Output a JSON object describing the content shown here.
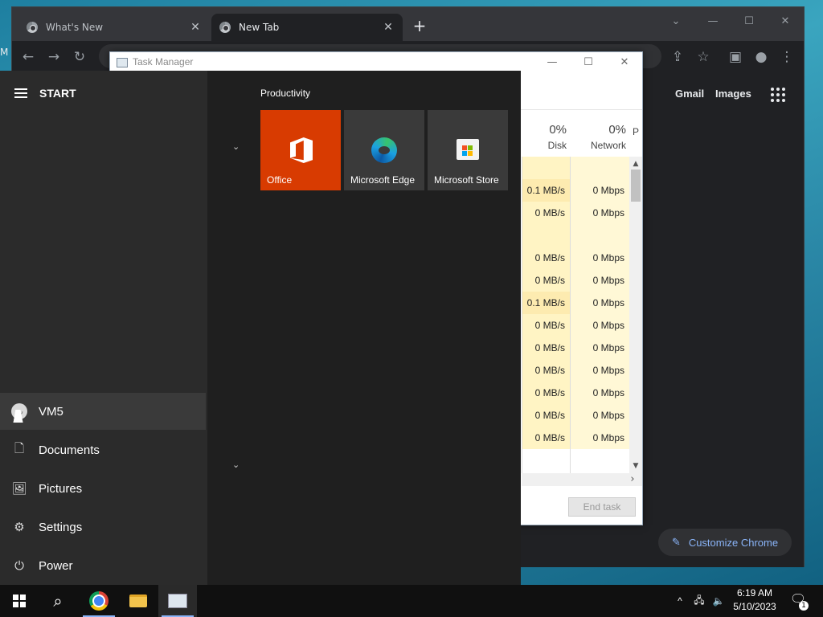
{
  "chrome": {
    "tabs": [
      {
        "title": "What's New",
        "close": "✕"
      },
      {
        "title": "New Tab",
        "close": "✕"
      }
    ],
    "new_tab": "+",
    "window_controls": {
      "dropdown": "⌄",
      "minimize": "—",
      "maximize": "☐",
      "close": "✕"
    },
    "toolbar": {
      "back": "←",
      "forward": "→",
      "reload": "↻",
      "share": "⇪",
      "bookmark": "☆",
      "sidepanel": "▣",
      "profile": "●",
      "menu": "⋮"
    },
    "side_letter": "M",
    "ntp": {
      "gmail": "Gmail",
      "images": "Images",
      "customize": "Customize Chrome",
      "customize_icon": "✎"
    }
  },
  "task_manager": {
    "title": "Task Manager",
    "controls": {
      "minimize": "—",
      "maximize": "☐",
      "close": "✕"
    },
    "columns": [
      {
        "pct": "0%",
        "label": "Disk"
      },
      {
        "pct": "0%",
        "label": "Network"
      },
      {
        "pct": "",
        "label": "P"
      }
    ],
    "disk_values": [
      "",
      "0.1 MB/s",
      "0 MB/s",
      "",
      "0 MB/s",
      "0 MB/s",
      "0.1 MB/s",
      "0 MB/s",
      "0 MB/s",
      "0 MB/s",
      "0 MB/s",
      "0 MB/s",
      "0 MB/s"
    ],
    "network_values": [
      "",
      "0 Mbps",
      "0 Mbps",
      "",
      "0 Mbps",
      "0 Mbps",
      "0 Mbps",
      "0 Mbps",
      "0 Mbps",
      "0 Mbps",
      "0 Mbps",
      "0 Mbps",
      "0 Mbps"
    ],
    "scroll": {
      "up": "▲",
      "down": "▼",
      "right": "›"
    },
    "end_task": "End task"
  },
  "start_menu": {
    "title": "START",
    "group": "Productivity",
    "chevron": "⌄",
    "tiles": [
      {
        "label": "Office"
      },
      {
        "label": "Microsoft Edge"
      },
      {
        "label": "Microsoft Store"
      }
    ],
    "items": [
      {
        "label": "VM5",
        "icon": "user-icon"
      },
      {
        "label": "Documents",
        "icon": "document-icon",
        "glyph": "🗋"
      },
      {
        "label": "Pictures",
        "icon": "pictures-icon",
        "glyph": "🖼"
      },
      {
        "label": "Settings",
        "icon": "gear-icon",
        "glyph": "⚙"
      },
      {
        "label": "Power",
        "icon": "power-icon",
        "glyph": "⏻"
      }
    ]
  },
  "taskbar": {
    "search_glyph": "⌕",
    "tray": {
      "chevron": "^",
      "network": "🖧",
      "volume": "🔈"
    },
    "time": "6:19 AM",
    "date": "5/10/2023",
    "notifications": "1",
    "notif_glyph": "🗨"
  },
  "colors": {
    "office": "#d83b01",
    "accent_link": "#8ab4f8",
    "taskbar": "#101010"
  }
}
